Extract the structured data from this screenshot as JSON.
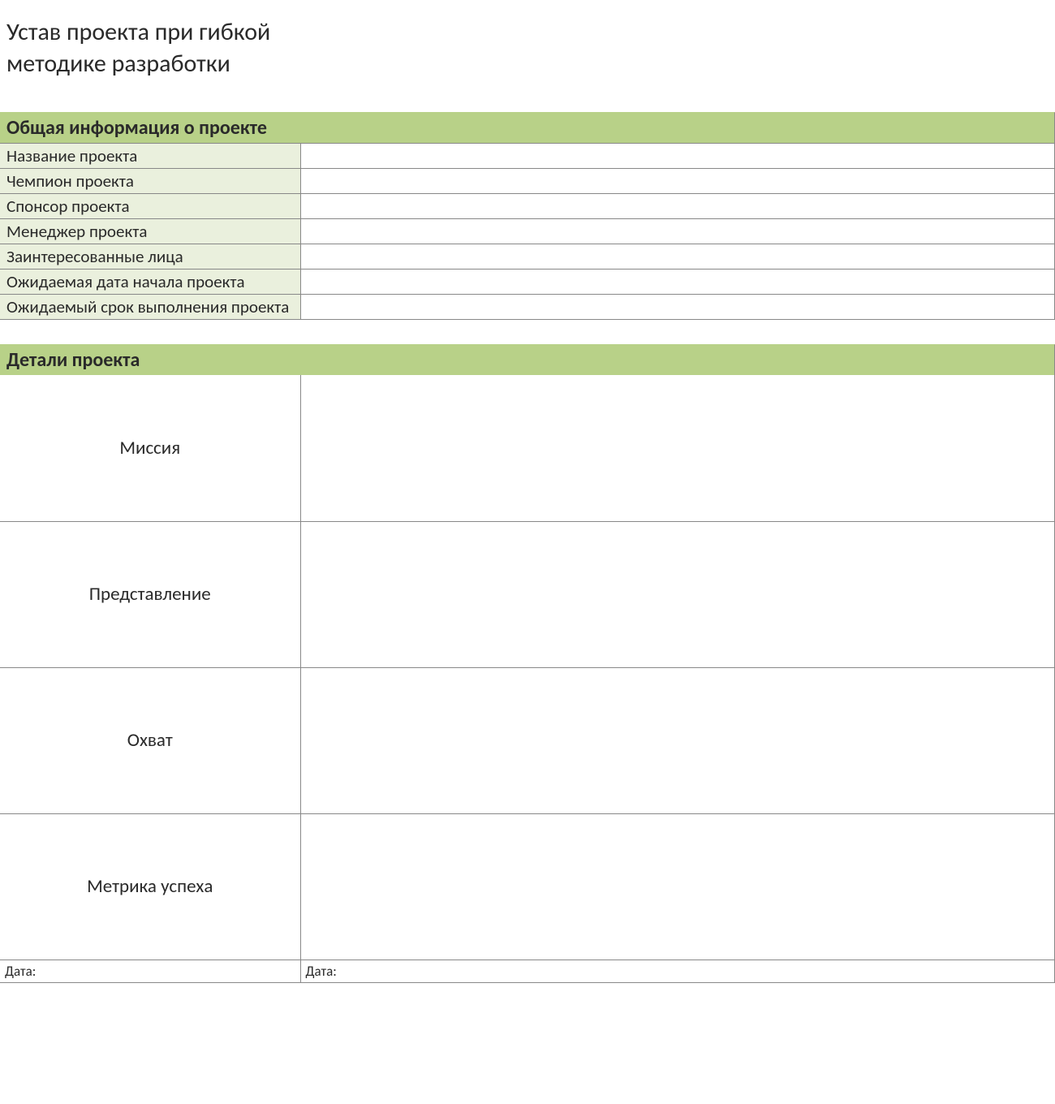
{
  "title_line1": "Устав проекта при гибкой",
  "title_line2": "методике разработки",
  "sections": {
    "general_info": {
      "header": "Общая информация о проекте",
      "rows": [
        {
          "label": "Название проекта",
          "value": ""
        },
        {
          "label": "Чемпион проекта",
          "value": ""
        },
        {
          "label": "Спонсор проекта",
          "value": ""
        },
        {
          "label": "Менеджер проекта",
          "value": ""
        },
        {
          "label": "Заинтересованные лица",
          "value": ""
        },
        {
          "label": "Ожидаемая дата начала проекта",
          "value": ""
        },
        {
          "label": "Ожидаемый срок выполнения проекта",
          "value": ""
        }
      ]
    },
    "details": {
      "header": "Детали проекта",
      "rows": [
        {
          "label": "Миссия",
          "value": ""
        },
        {
          "label": "Представление",
          "value": ""
        },
        {
          "label": "Охват",
          "value": ""
        },
        {
          "label": "Метрика успеха",
          "value": ""
        }
      ]
    }
  },
  "footer": {
    "date1": "Дата:",
    "date2": "Дата:"
  }
}
